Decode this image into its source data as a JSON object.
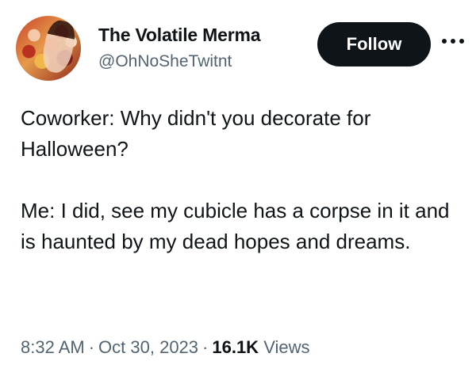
{
  "author": {
    "display_name": "The Volatile Merma",
    "handle": "@OhNoSheTwitnt",
    "avatar_icon": "profile-photo"
  },
  "actions": {
    "follow_label": "Follow",
    "more_icon": "more-options-icon"
  },
  "tweet": {
    "paragraphs": [
      "Coworker: Why didn't you decorate for Halloween?",
      "Me: I did, see my cubicle has a corpse in it and is haunted by my dead hopes and dreams."
    ]
  },
  "meta": {
    "time": "8:32 AM",
    "separator": "·",
    "date": "Oct 30, 2023",
    "views_count": "16.1K",
    "views_label": "Views"
  },
  "colors": {
    "text": "#0f1419",
    "secondary": "#536471",
    "button_bg": "#0f1419",
    "button_text": "#ffffff",
    "background": "#ffffff"
  }
}
